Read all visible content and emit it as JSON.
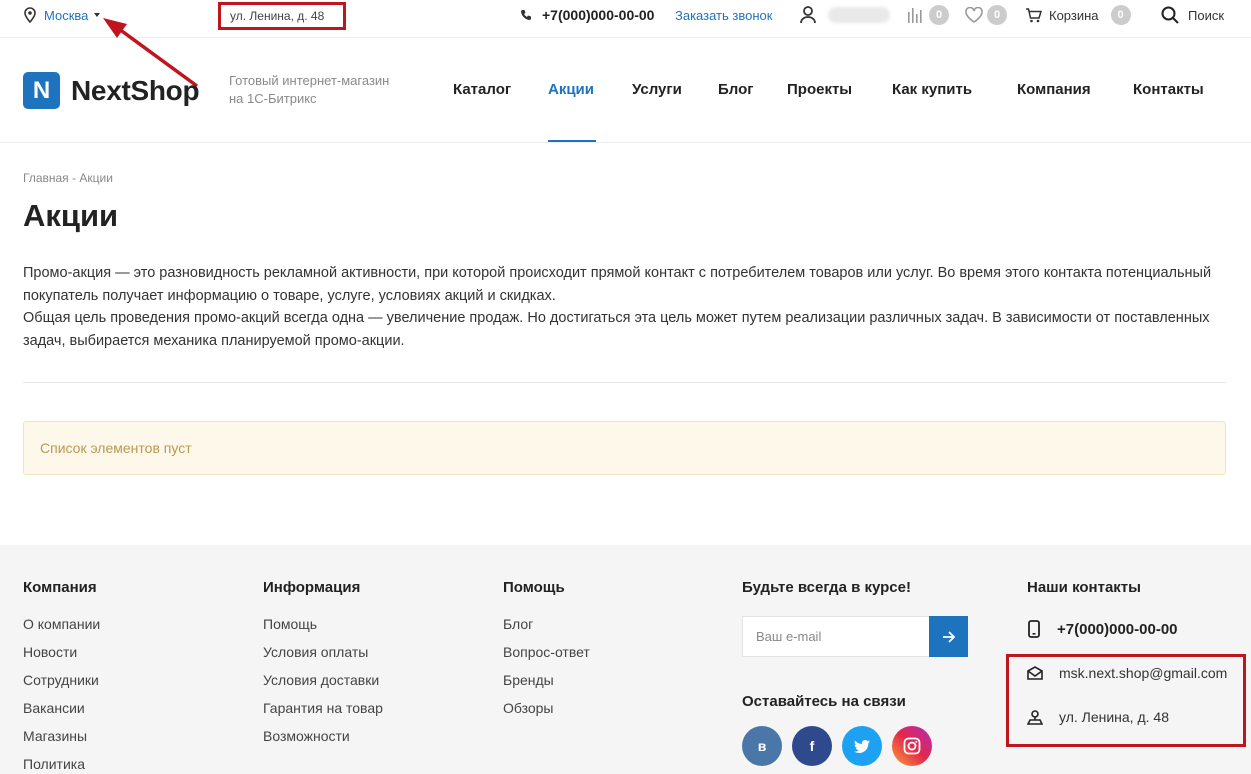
{
  "topbar": {
    "city": "Москва",
    "address": "ул. Ленина, д. 48",
    "phone": "+7(000)000-00-00",
    "callback": "Заказать звонок",
    "compare_count": "0",
    "favorites_count": "0",
    "cart_label": "Корзина",
    "cart_count": "0",
    "search_label": "Поиск"
  },
  "header": {
    "logo_mark": "N",
    "logo_text": "NextShop",
    "slogan": "Готовый интернет-магазин на 1С-Битрикс",
    "nav": [
      "Каталог",
      "Акции",
      "Услуги",
      "Блог",
      "Проекты",
      "Как купить",
      "Компания",
      "Контакты"
    ],
    "active_nav": "Акции"
  },
  "breadcrumb": {
    "home": "Главная",
    "sep": "-",
    "current": "Акции"
  },
  "page": {
    "title": "Акции",
    "intro_1": "Промо-акция — это разновидность рекламной активности, при которой происходит прямой контакт с потребителем товаров или услуг. Во время этого контакта потенциальный покупатель получает информацию о товаре, услуге, условиях акций и скидках.",
    "intro_2": "Общая цель проведения промо-акций всегда одна — увеличение продаж. Но достигаться эта цель может путем реализации различных задач. В зависимости от поставленных задач, выбирается механика планируемой промо-акции.",
    "empty_notice": "Список элементов пуст"
  },
  "footer": {
    "company": {
      "title": "Компания",
      "links": [
        "О компании",
        "Новости",
        "Сотрудники",
        "Вакансии",
        "Магазины",
        "Политика"
      ]
    },
    "info": {
      "title": "Информация",
      "links": [
        "Помощь",
        "Условия оплаты",
        "Условия доставки",
        "Гарантия на товар",
        "Возможности"
      ]
    },
    "help": {
      "title": "Помощь",
      "links": [
        "Блог",
        "Вопрос-ответ",
        "Бренды",
        "Обзоры"
      ]
    },
    "subscribe": {
      "title": "Будьте всегда в курсе!",
      "placeholder": "Ваш e-mail",
      "stay_title": "Оставайтесь на связи"
    },
    "social": [
      "в",
      "f",
      "twitter-icon",
      "instagram-icon"
    ],
    "contacts": {
      "title": "Наши контакты",
      "phone": "+7(000)000-00-00",
      "email": "msk.next.shop@gmail.com",
      "address": "ул. Ленина, д. 48"
    }
  },
  "colors": {
    "accent": "#1e73be",
    "highlight": "#c0151f",
    "notice_bg": "#fdf8e9"
  }
}
